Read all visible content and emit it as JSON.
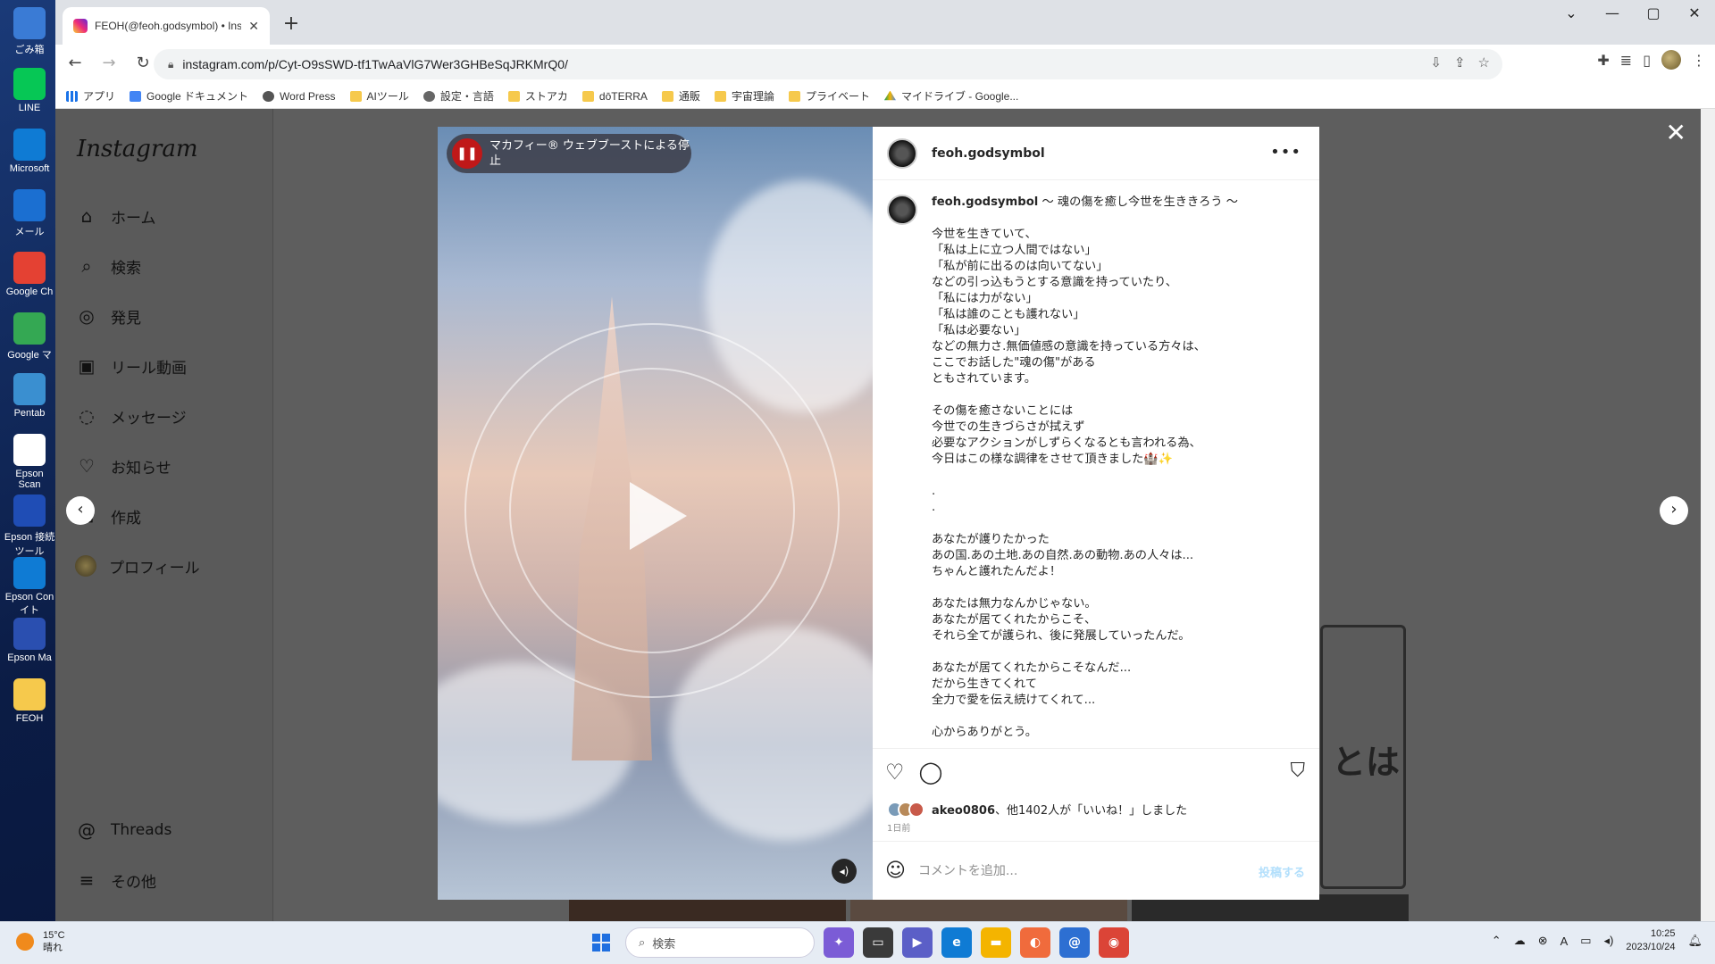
{
  "desktop": {
    "icons": [
      {
        "label": "ごみ箱",
        "color": "#3a7bd5"
      },
      {
        "label": "LINE",
        "color": "#06c755"
      },
      {
        "label": "Microsoft",
        "color": "#0f7bd4"
      },
      {
        "label": "メール",
        "color": "#1b6fd1"
      },
      {
        "label": "Google Ch",
        "color": "#e44133"
      },
      {
        "label": "Google マ",
        "color": "#34a853"
      },
      {
        "label": "Pentab",
        "color": "#3a8fd0"
      },
      {
        "label": "Epson Scan",
        "color": "#ffffff"
      },
      {
        "label": "Epson 接続ツール",
        "color": "#1f4db5"
      },
      {
        "label": "Epson Con イト",
        "color": "#0f7bd4"
      },
      {
        "label": "Epson Ma",
        "color": "#2a4fb0"
      },
      {
        "label": "FEOH",
        "color": "#f6c94c"
      }
    ]
  },
  "browser": {
    "tab_title": "FEOH(@feoh.godsymbol) • Insta",
    "tab_close": "✕",
    "new_tab": "+",
    "window_controls": [
      "⌄",
      "—",
      "▢",
      "✕"
    ],
    "url": "instagram.com/p/Cyt-O9sSWD-tf1TwAaVlG7Wer3GHBeSqJRKMrQ0/",
    "bookmarks": [
      {
        "label": "アプリ",
        "icon": "apps"
      },
      {
        "label": "Google ドキュメント",
        "icon": "doc"
      },
      {
        "label": "Word Press",
        "icon": "wp"
      },
      {
        "label": "AIツール",
        "icon": "folder"
      },
      {
        "label": "設定・言語",
        "icon": "gear"
      },
      {
        "label": "ストアカ",
        "icon": "folder"
      },
      {
        "label": "dōTERRA",
        "icon": "folder"
      },
      {
        "label": "通販",
        "icon": "folder"
      },
      {
        "label": "宇宙理論",
        "icon": "folder"
      },
      {
        "label": "プライベート",
        "icon": "folder"
      },
      {
        "label": "マイドライブ - Google...",
        "icon": "drive"
      }
    ]
  },
  "instagram": {
    "logo": "Instagram",
    "nav": [
      {
        "label": "ホーム",
        "icon": "home-icon",
        "glyph": "⌂"
      },
      {
        "label": "検索",
        "icon": "search-icon",
        "glyph": "⌕"
      },
      {
        "label": "発見",
        "icon": "compass-icon",
        "glyph": "◎"
      },
      {
        "label": "リール動画",
        "icon": "reels-icon",
        "glyph": "▣"
      },
      {
        "label": "メッセージ",
        "icon": "messenger-icon",
        "glyph": "◌"
      },
      {
        "label": "お知らせ",
        "icon": "heart-icon",
        "glyph": "♡"
      },
      {
        "label": "作成",
        "icon": "create-icon",
        "glyph": "⊞"
      },
      {
        "label": "プロフィール",
        "icon": "profile-avatar",
        "glyph": ""
      }
    ],
    "bottom_nav": [
      {
        "label": "Threads",
        "icon": "threads-icon",
        "glyph": "@"
      },
      {
        "label": "その他",
        "icon": "menu-icon",
        "glyph": "≡"
      }
    ],
    "bg_card_text": "とは"
  },
  "post": {
    "mcafee_text": "マカフィー® ウェブブーストによる停止",
    "username": "feoh.godsymbol",
    "more": "•••",
    "caption_title": "〜 魂の傷を癒し今世を生ききろう 〜",
    "caption": "今世を生きていて、\n「私は上に立つ人間ではない」\n「私が前に出るのは向いてない」\nなどの引っ込もうとする意識を持っていたり、\n「私には力がない」\n「私は誰のことも護れない」\n「私は必要ない」\nなどの無力さ.無価値感の意識を持っている方々は、\nここでお話した\"魂の傷\"がある\nともされています。\n\nその傷を癒さないことには\n今世での生きづらさが拭えず\n必要なアクションがしずらくなるとも言われる為、\n今日はこの様な調律をさせて頂きました🏰✨\n\n.\n.\n\nあなたが護りたかった\nあの国.あの土地.あの自然.あの動物.あの人々は...\nちゃんと護れたんだよ！\n\nあなたは無力なんかじゃない。\nあなたが居てくれたからこそ、\nそれら全てが護られ、後に発展していったんだ。\n\nあなたが居てくれたからこそなんだ...\nだから生きてくれて\n全力で愛を伝え続けてくれて...\n\n心からありがとう。",
    "likes_user": "akeo0806",
    "likes_rest": "、他1402人が「いいね！」しました",
    "date": "1日前",
    "comment_placeholder": "コメントを追加...",
    "post_button": "投稿する"
  },
  "taskbar": {
    "temp": "15°C",
    "weather": "晴れ",
    "search_placeholder": "検索",
    "time": "10:25",
    "date": "2023/10/24",
    "apps": [
      {
        "name": "copilot-app",
        "color": "#7b5cd6",
        "glyph": "✦"
      },
      {
        "name": "task-view-app",
        "color": "#3a3a3a",
        "glyph": "▭"
      },
      {
        "name": "teams-app",
        "color": "#5b5fc7",
        "glyph": "▶"
      },
      {
        "name": "edge-app",
        "color": "#0f7bd4",
        "glyph": "e"
      },
      {
        "name": "explorer-app",
        "color": "#f4b400",
        "glyph": "▬"
      },
      {
        "name": "sketch-app",
        "color": "#f06b3c",
        "glyph": "◐"
      },
      {
        "name": "mail-app",
        "color": "#2d6fd2",
        "glyph": "@"
      },
      {
        "name": "chrome-app",
        "color": "#db4437",
        "glyph": "◉"
      }
    ]
  }
}
